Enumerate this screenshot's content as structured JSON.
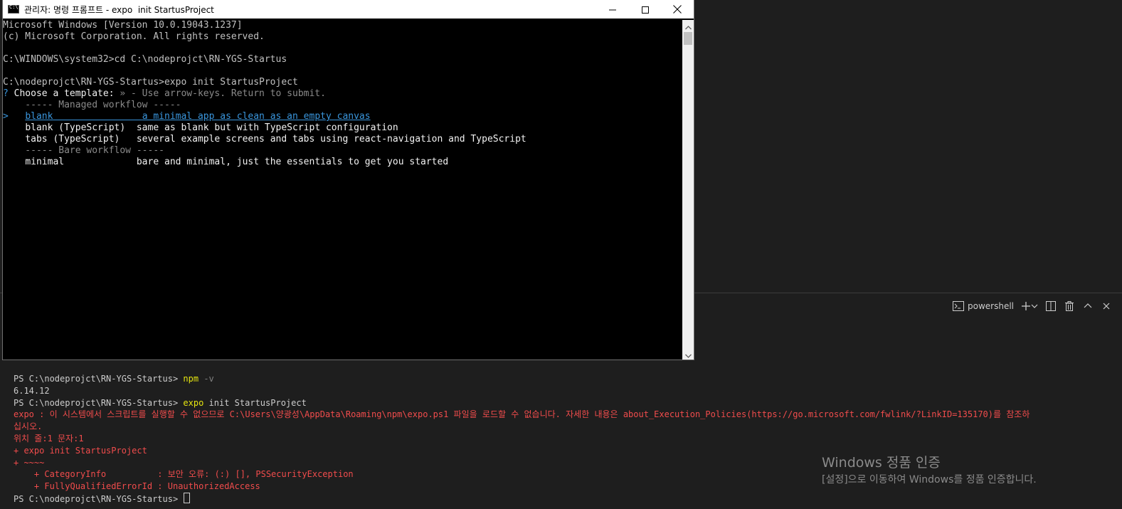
{
  "cmd_window": {
    "title": "관리자: 명령 프롬프트 - expo  init StartusProject",
    "controls": {
      "minimize": "minimize-icon",
      "maximize": "maximize-icon",
      "close": "close-icon"
    },
    "lines": [
      "Microsoft Windows [Version 10.0.19043.1237]",
      "(c) Microsoft Corporation. All rights reserved.",
      "",
      "C:\\WINDOWS\\system32>cd C:\\nodeprojct\\RN-YGS-Startus",
      "",
      "C:\\nodeprojct\\RN-YGS-Startus>expo init StartusProject"
    ],
    "prompt": {
      "mark": "?",
      "question": "Choose a template:",
      "hint": " » - Use arrow-keys. Return to submit."
    },
    "managed_header": "    ----- Managed workflow -----",
    "pointer": ">",
    "options": [
      {
        "name": "blank",
        "description": "a minimal app as clean as an empty canvas",
        "selected": true
      },
      {
        "name": "blank (TypeScript)",
        "description": "same as blank but with TypeScript configuration",
        "selected": false
      },
      {
        "name": "tabs (TypeScript)",
        "description": "several example screens and tabs using react-navigation and TypeScript",
        "selected": false
      }
    ],
    "bare_header": "    ----- Bare workflow -----",
    "bare_options": [
      {
        "name": "minimal",
        "description": "bare and minimal, just the essentials to get you started"
      }
    ]
  },
  "vscode_panel": {
    "terminal_name": "powershell",
    "icons": {
      "terminal": "terminal-icon",
      "add": "plus-icon",
      "dropdown": "chevron-down-icon",
      "split": "split-icon",
      "kill": "trash-icon",
      "maximize": "chevron-up-icon",
      "close": "close-icon"
    },
    "output": {
      "prompt1": "PS C:\\nodeprojct\\RN-YGS-Startus> ",
      "cmd1": "npm",
      "cmd1_args": " -v",
      "line2": "6.14.12",
      "prompt3": "PS C:\\nodeprojct\\RN-YGS-Startus> ",
      "cmd3": "expo",
      "cmd3_args": " init StartusProject",
      "error1": "expo : 이 시스템에서 스크립트를 실행할 수 없으므로 C:\\Users\\양광성\\AppData\\Roaming\\npm\\expo.ps1 파일을 로드할 수 없습니다. 자세한 내용은 about_Execution_Policies(https://go.microsoft.com/fwlink/?LinkID=135170)를 참조하",
      "error2": "십시오.",
      "error3": "위치 줄:1 문자:1",
      "error4": "+ expo init StartusProject",
      "error5": "+ ~~~~",
      "error6": "    + CategoryInfo          : 보안 오류: (:) [], PSSecurityException",
      "error7": "    + FullyQualifiedErrorId : UnauthorizedAccess",
      "prompt_last": "PS C:\\nodeprojct\\RN-YGS-Startus> "
    }
  },
  "activation": {
    "title": "Windows 정품 인증",
    "subtitle": "[설정]으로 이동하여 Windows를 정품 인증합니다."
  },
  "colors": {
    "cmd_background": "#000000",
    "cmd_text": "#c0c0c0",
    "cmd_cyan": "#3a96dd",
    "vscode_background": "#1e1e1e",
    "ps_command": "#e5e510",
    "ps_error": "#f14c4c"
  }
}
